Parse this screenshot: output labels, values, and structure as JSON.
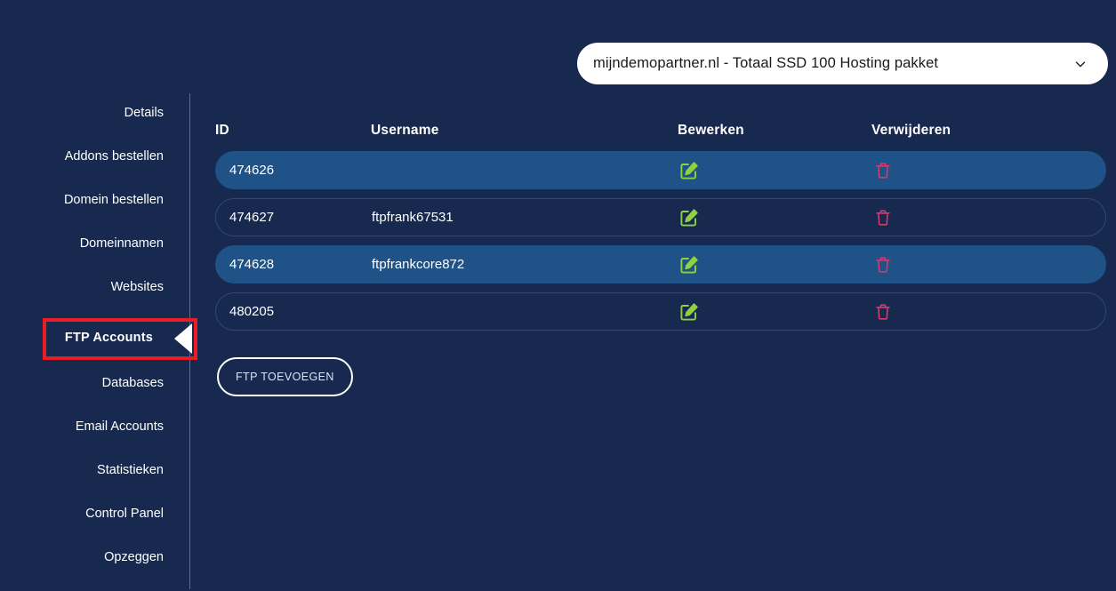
{
  "header": {
    "package_selector": {
      "value": "mijndemopartner.nl - Totaal SSD 100 Hosting pakket",
      "icon": "chevron-down-icon"
    }
  },
  "sidebar": {
    "items": [
      {
        "label": "Details",
        "active": false
      },
      {
        "label": "Addons bestellen",
        "active": false
      },
      {
        "label": "Domein bestellen",
        "active": false
      },
      {
        "label": "Domeinnamen",
        "active": false
      },
      {
        "label": "Websites",
        "active": false
      },
      {
        "label": "FTP Accounts",
        "active": true
      },
      {
        "label": "Databases",
        "active": false
      },
      {
        "label": "Email Accounts",
        "active": false
      },
      {
        "label": "Statistieken",
        "active": false
      },
      {
        "label": "Control Panel",
        "active": false
      },
      {
        "label": "Opzeggen",
        "active": false
      }
    ]
  },
  "main": {
    "table": {
      "columns": [
        "ID",
        "Username",
        "Bewerken",
        "Verwijderen"
      ],
      "rows": [
        {
          "id": "474626",
          "username": "",
          "edit_icon": "edit-pencil-icon",
          "delete_icon": "trash-icon"
        },
        {
          "id": "474627",
          "username": "ftpfrank67531",
          "edit_icon": "edit-pencil-icon",
          "delete_icon": "trash-icon"
        },
        {
          "id": "474628",
          "username": "ftpfrankcore872",
          "edit_icon": "edit-pencil-icon",
          "delete_icon": "trash-icon"
        },
        {
          "id": "480205",
          "username": "",
          "edit_icon": "edit-pencil-icon",
          "delete_icon": "trash-icon"
        }
      ]
    },
    "add_button": {
      "label": "FTP TOEVOEGEN"
    }
  },
  "colors": {
    "background": "#17294f",
    "row_highlight": "#1f5286",
    "divider": "#4a7fc1",
    "edit_icon": "#8ed23f",
    "delete_icon": "#d6386b",
    "annotation_box": "#ed1c24",
    "annotation_arrow": "#ffffff"
  }
}
